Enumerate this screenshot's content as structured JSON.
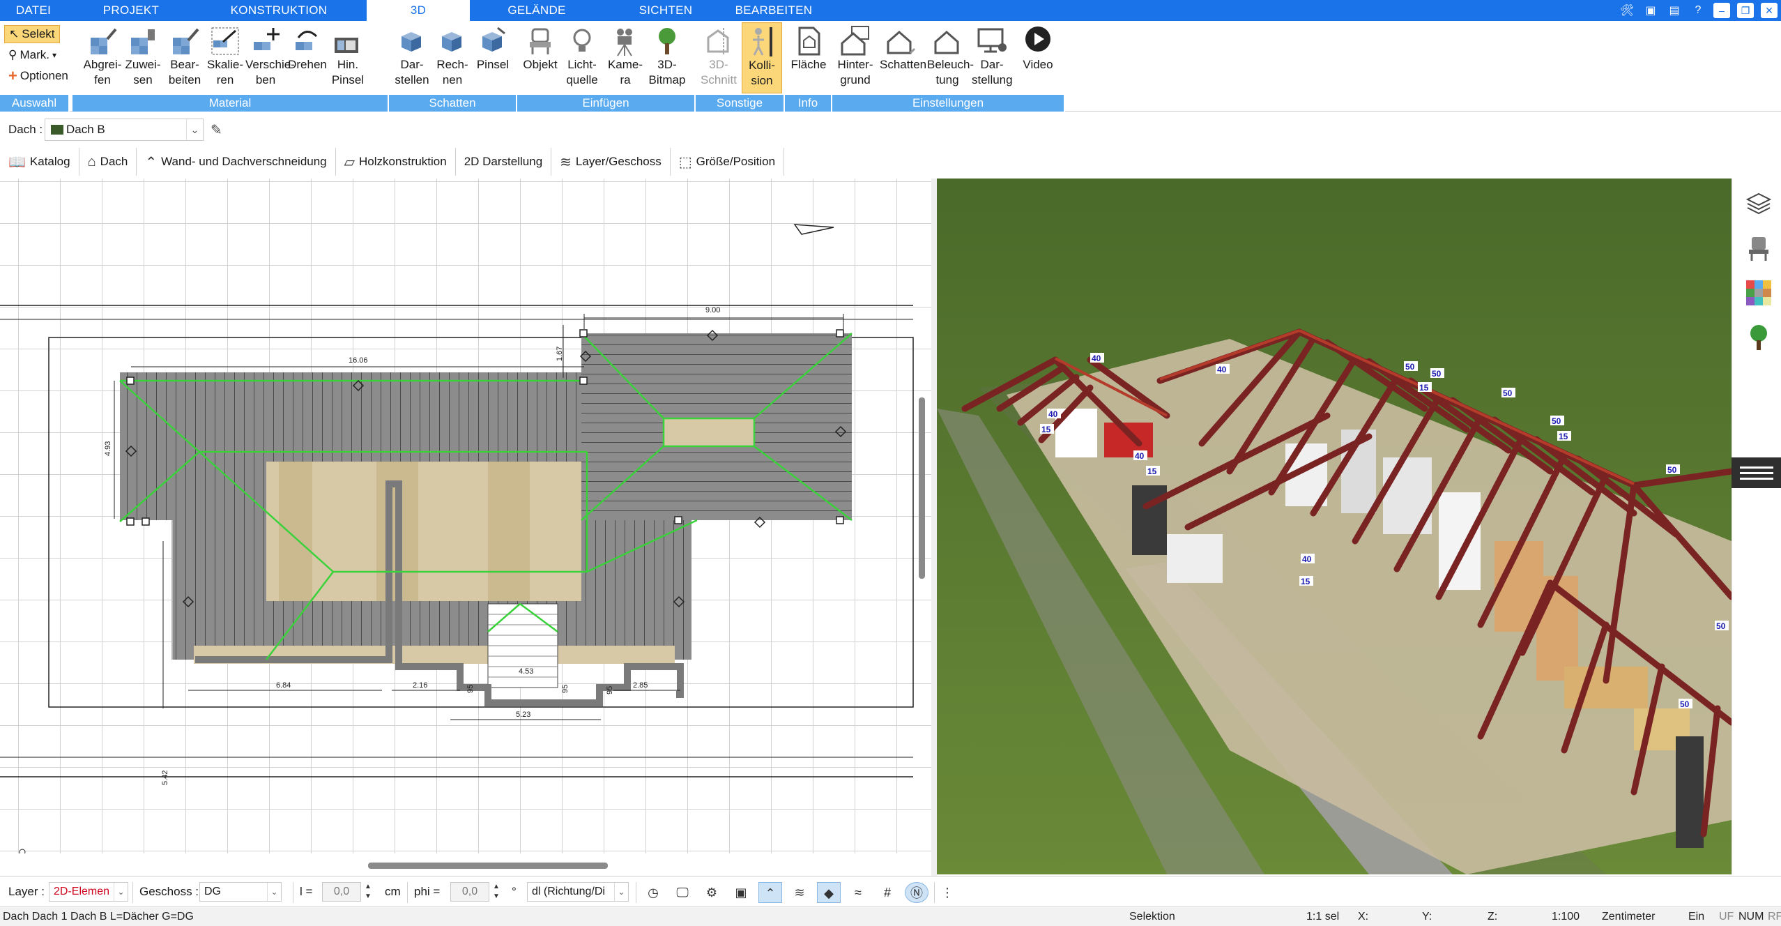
{
  "menu": {
    "tabs": [
      {
        "label": "DATEI",
        "active": false
      },
      {
        "label": "PROJEKT",
        "active": false
      },
      {
        "label": "KONSTRUKTION",
        "active": false
      },
      {
        "label": "3D",
        "active": true
      },
      {
        "label": "GELÄNDE",
        "active": false
      },
      {
        "label": "SICHTEN",
        "active": false
      },
      {
        "label": "BEARBEITEN",
        "active": false
      }
    ],
    "window_controls": [
      "tools-icon",
      "cube-icon",
      "layers-icon",
      "help-icon",
      "minimize-icon",
      "restore-icon",
      "close-icon"
    ]
  },
  "ribbon": {
    "auswahl": {
      "items": [
        "Selekt",
        "Mark.",
        "Optionen"
      ],
      "group": "Auswahl"
    },
    "material": {
      "buttons": [
        "Abgrei-\nfen",
        "Zuwei-\nsen",
        "Bear-\nbeiten",
        "Skalie-\nren",
        "Verschie-\nben",
        "Drehen",
        "Hin.\nPinsel"
      ],
      "group": "Material"
    },
    "schatten": {
      "buttons": [
        "Dar-\nstellen",
        "Rech-\nnen",
        "Pinsel"
      ],
      "group": "Schatten"
    },
    "einfuegen": {
      "buttons": [
        "Objekt",
        "Licht-\nquelle",
        "Kame-\nra",
        "3D-\nBitmap"
      ],
      "group": "Einfügen"
    },
    "sonstige": {
      "buttons": [
        "3D-\nSchnitt",
        "Kolli-\nsion"
      ],
      "group": "Sonstige"
    },
    "info": {
      "buttons": [
        "Fläche"
      ],
      "group": "Info"
    },
    "einstellungen": {
      "buttons": [
        "Hinter-\ngrund",
        "Schatten",
        "Beleuch-\ntung",
        "Dar-\nstellung",
        "Video"
      ],
      "group": "Einstellungen"
    }
  },
  "object_bar": {
    "label": "Dach :",
    "value": "Dach B"
  },
  "toolbar2": {
    "items": [
      "Katalog",
      "Dach",
      "Wand- und Dachverschneidung",
      "Holzkonstruktion",
      "2D Darstellung",
      "Layer/Geschoss",
      "Größe/Position"
    ]
  },
  "plan": {
    "dimensions": [
      "9.00",
      "16.06",
      "4.93",
      "5.42",
      "6.84",
      "2.16",
      "2.85",
      "5.23",
      "4.53",
      "95",
      "95",
      "95",
      "1.67"
    ]
  },
  "view3d": {
    "labels": [
      "40",
      "40",
      "40",
      "40",
      "40",
      "15",
      "15",
      "15",
      "15",
      "15",
      "50",
      "50",
      "50",
      "50",
      "50",
      "50",
      "50"
    ]
  },
  "propbar": {
    "layer_label": "Layer :",
    "layer_value": "2D-Elemen",
    "geschoss_label": "Geschoss :",
    "geschoss_value": "DG",
    "l_label": "l =",
    "l_value": "0,0",
    "l_unit": "cm",
    "phi_label": "phi =",
    "phi_value": "0,0",
    "phi_unit": "°",
    "dl_value": "dl (Richtung/Di"
  },
  "status": {
    "left": "Dach Dach 1 Dach B L=Dächer G=DG",
    "mode": "Selektion",
    "sel": "1:1 sel",
    "x": "X:",
    "y": "Y:",
    "z": "Z:",
    "scale": "1:100",
    "unit": "Zentimeter",
    "ein": "Ein",
    "uf": "UF",
    "num": "NUM",
    "rf": "RF"
  },
  "colors": {
    "accent": "#1a73e8",
    "group_label": "#5aaaf0",
    "active_button": "#fbd77a",
    "roof_fill": "#8c8c8c",
    "ridge_line": "#3ad23a",
    "beam": "#7a2323",
    "grass": "#5f7a31"
  }
}
